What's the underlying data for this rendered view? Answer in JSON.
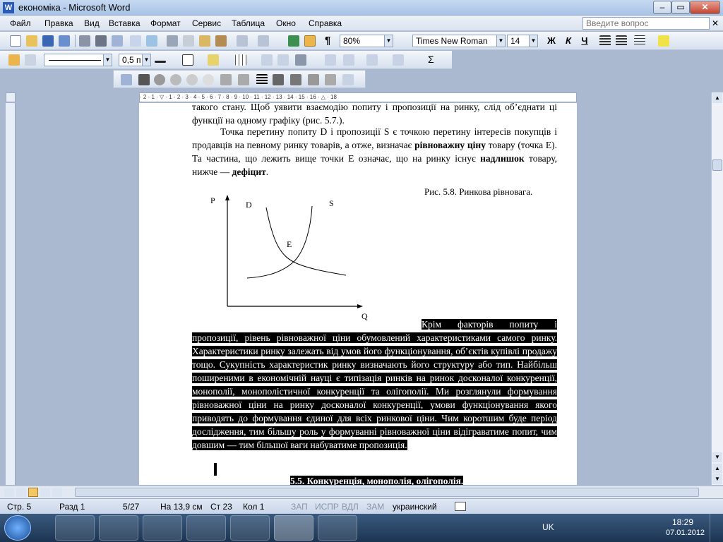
{
  "window": {
    "title": "економіка - Microsoft Word",
    "help_placeholder": "Введите вопрос"
  },
  "menu": [
    "Файл",
    "Правка",
    "Вид",
    "Вставка",
    "Формат",
    "Сервис",
    "Таблица",
    "Окно",
    "Справка"
  ],
  "toolbar": {
    "zoom": "80%",
    "font": "Times New Roman",
    "size": "14",
    "bold": "Ж",
    "italic": "К",
    "underline": "Ч",
    "line_width": "0,5 п",
    "pilcrow": "¶"
  },
  "ruler": {
    "ticks": "· 2 · 1 · ▽ · 1 · 2 · 3 · 4 · 5 · 6 · 7 · 8 · 9 · 10 · 11 · 12 · 13 · 14 · 15 · 16 · △ · 18"
  },
  "document": {
    "line_top": "такого стану. Щоб уявити взаємодію попиту і пропозиції на ринку, слід об’єднати ці функції на одному графіку (рис. 5.7.).",
    "para1_a": "Точка перетину попиту D і пропозиції S є точкою перетину інтересів покупців і продавців на певному ринку товарів, а отже, визначає ",
    "para1_b": "рівноважну ціну",
    "para1_c": " товару (точка Е). Та частина, що лежить вище точки Е означає, що на ринку існує ",
    "para1_d": "надлишок",
    "para1_e": " товару, нижче — ",
    "para1_f": "дефіцит",
    "para1_g": ".",
    "caption": "Рис. 5.8. Ринкова рівновага.",
    "sel_first": "Крім факторів попиту і пропозиції, рівень рівноважної ціни обумовлений характеристиками самого ринку. Характеристики ринку залежать від умов його функціонування, об’єктів купівлі продажу тощо. Сукупність характеристик ринку визначають його структуру або тип. Найбільш поширеними в економічній науці є типізація ринків на ринок досконалої конкуренції, монополії, монополістичної конкуренції та олігополії. Ми розглянули формування рівноважної ціни на ринку досконалої конкуренції, умови функціонування якого приводять до формування єдиної для всіх ринкової ціни. Чим коротшим буде період дослідження, тим більшу роль у формуванні рівноважної ціни відіграватиме попит, чим довшим — тим більшої ваги набуватиме пропозиція. ",
    "heading": "5.5. Конкуренція, монополія, олігополія."
  },
  "chart_data": {
    "type": "diagram",
    "labels": {
      "p": "P",
      "q": "Q",
      "d": "D",
      "s": "S",
      "e": "E"
    }
  },
  "status": {
    "page": "Стр. 5",
    "section": "Разд 1",
    "pages": "5/27",
    "at": "На 13,9 см",
    "line": "Ст 23",
    "col": "Кол 1",
    "rec": "ЗАП",
    "trk": "ИСПР",
    "ext": "ВДЛ",
    "ovr": "ЗАМ",
    "lang": "украинский"
  },
  "tray": {
    "lang": "UK",
    "time": "18:29",
    "date": "07.01.2012"
  },
  "colors": {
    "titlebar": "#c6d9f1",
    "selection": "#000000",
    "taskbar": "#1c3452"
  }
}
